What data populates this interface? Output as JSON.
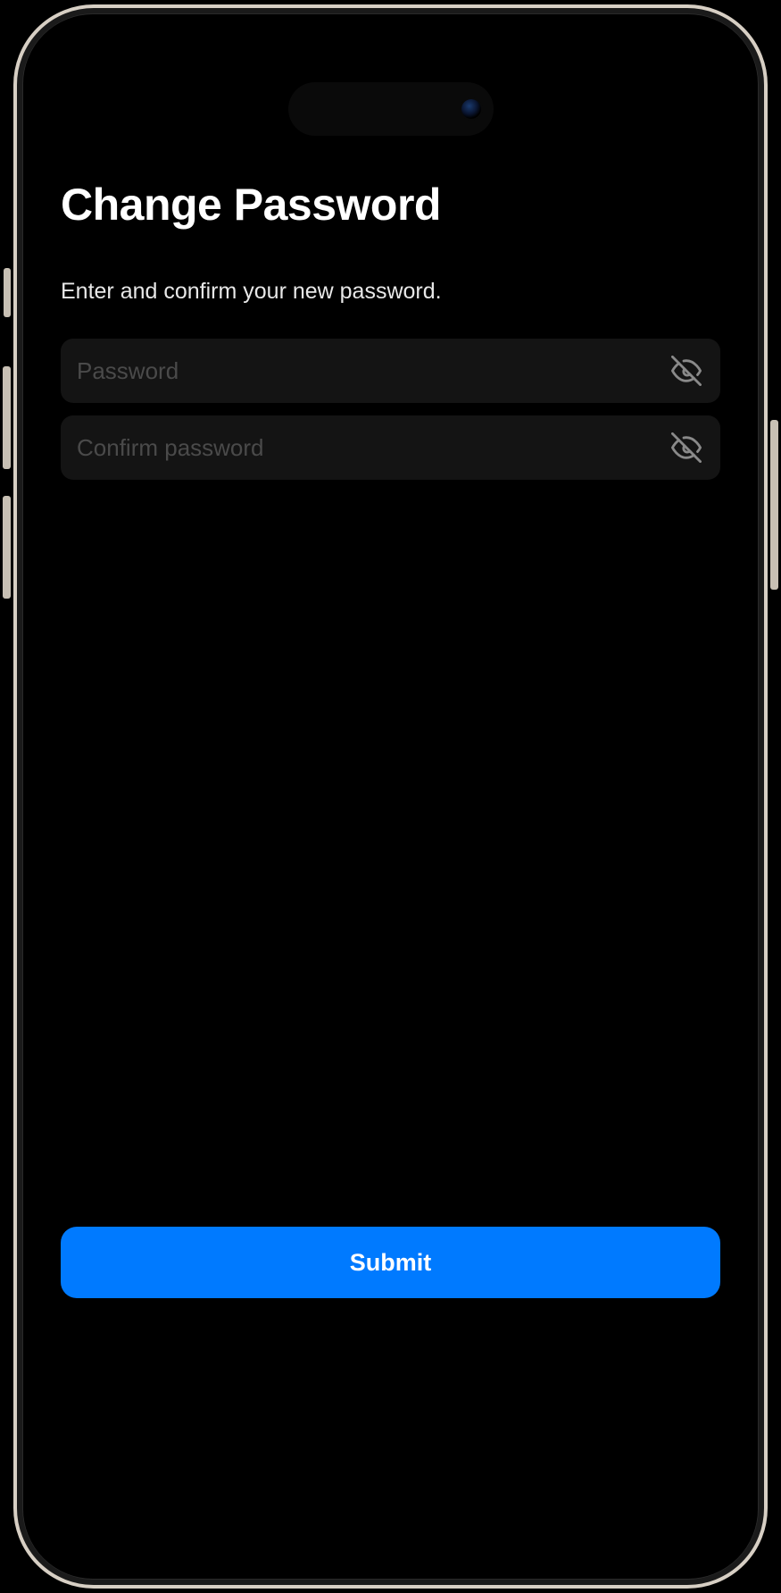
{
  "header": {
    "title": "Change Password",
    "subtitle": "Enter and confirm your new password."
  },
  "form": {
    "password": {
      "placeholder": "Password",
      "value": "",
      "visible": false
    },
    "confirm_password": {
      "placeholder": "Confirm password",
      "value": "",
      "visible": false
    },
    "submit_label": "Submit"
  },
  "icons": {
    "eye_slash": "eye-slash-icon"
  },
  "colors": {
    "accent": "#007aff",
    "background": "#000000",
    "input_bg": "#141414",
    "placeholder": "#4a4a4a",
    "icon": "#8a8a8a"
  }
}
